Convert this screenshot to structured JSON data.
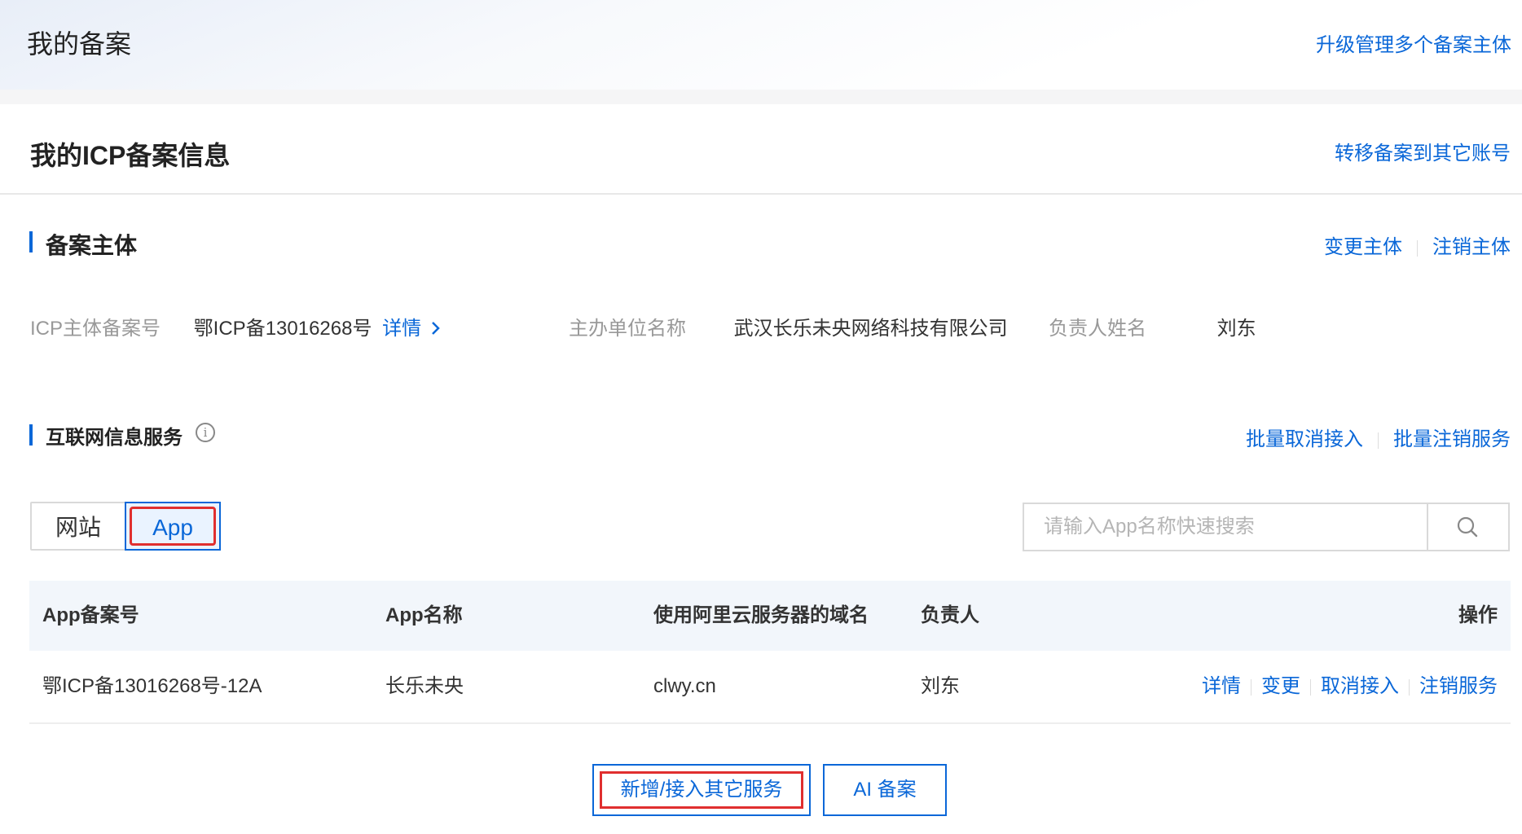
{
  "header": {
    "title": "我的备案",
    "upgrade_link": "升级管理多个备案主体"
  },
  "card": {
    "title": "我的ICP备案信息",
    "transfer_link": "转移备案到其它账号"
  },
  "subject_section": {
    "title": "备案主体",
    "actions": [
      "变更主体",
      "注销主体"
    ],
    "fields": {
      "icp_label": "ICP主体备案号",
      "icp_value": "鄂ICP备13016268号",
      "detail_link": "详情",
      "org_label": "主办单位名称",
      "org_value": "武汉长乐未央网络科技有限公司",
      "owner_label": "负责人姓名",
      "owner_value": "刘东"
    }
  },
  "service_section": {
    "title": "互联网信息服务",
    "info_icon": "info-icon",
    "actions": [
      "批量取消接入",
      "批量注销服务"
    ],
    "tabs": [
      "网站",
      "App"
    ],
    "active_tab": "App",
    "search": {
      "placeholder": "请输入App名称快速搜索",
      "value": "",
      "icon": "search-icon"
    },
    "table": {
      "columns": [
        "App备案号",
        "App名称",
        "使用阿里云服务器的域名",
        "负责人",
        "操作"
      ],
      "rows": [
        {
          "record_no": "鄂ICP备13016268号-12A",
          "name": "长乐未央",
          "domain": "clwy.cn",
          "owner": "刘东",
          "ops": [
            "详情",
            "变更",
            "取消接入",
            "注销服务"
          ]
        }
      ]
    },
    "buttons": {
      "add": "新增/接入其它服务",
      "ai": "AI 备案"
    }
  },
  "colors": {
    "primary": "#0a67d8",
    "highlight_box": "#e02f2f",
    "table_header_bg": "#f2f6fb"
  }
}
